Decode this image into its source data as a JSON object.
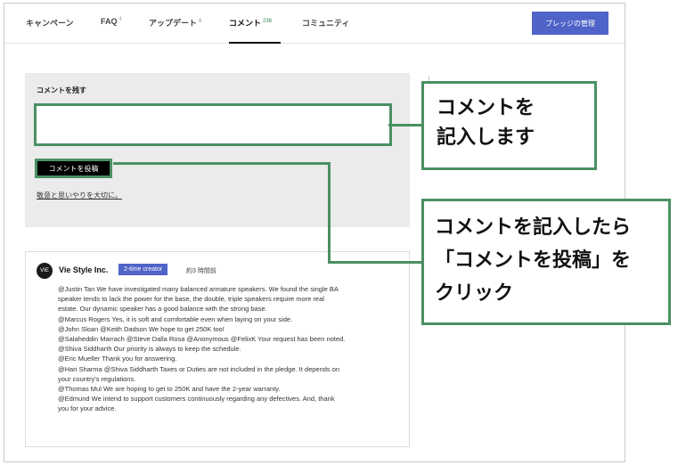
{
  "nav": {
    "tabs": [
      {
        "label": "キャンペーン",
        "count": ""
      },
      {
        "label": "FAQ",
        "count": "4"
      },
      {
        "label": "アップデート",
        "count": "6"
      },
      {
        "label": "コメント",
        "count": "236"
      },
      {
        "label": "コミュニティ",
        "count": ""
      }
    ],
    "active_tab": "コメント",
    "pledge_button": "プレッジの管理"
  },
  "comment_form": {
    "title": "コメントを残す",
    "input_value": "",
    "submit_label": "コメントを投稿",
    "policy_link": "敬意と思いやりを大切に。"
  },
  "comment": {
    "avatar_text": "VIE",
    "author": "Vie Style Inc.",
    "badge": "2-time creator",
    "time": "約3 時間前",
    "lines": [
      "@Justin Tan We have investigated many balanced armature speakers. We found the single BA",
      "speaker tends to lack the power for the base, the double, triple speakers require more real",
      "estate. Our dynamic speaker has a good balance with the strong base.",
      "@Marcus Rogers Yes, it is soft and comfortable even when laying on your side.",
      "@John Sloan @Keith Dadson We hope to get 250K too!",
      "@Salaheddin Marrach @Steve Dalla Rosa @Anonymous @FelixK Your request has been noted.",
      "@Shiva Siddharth Our priority is always to keep the schedule.",
      "@Eric Mueller Thank you for answering.",
      "@Hari Sharma @Shiva Siddharth Taxes or Duties are not included in the pledge. It depends on",
      "your country's regulations.",
      "@Thomas Mul We are hoping to get to 250K and have the 2-year warranty.",
      "@Edmund We intend to support customers continuously regarding any defectives. And, thank",
      "you for your advice."
    ]
  },
  "callouts": {
    "input_note": [
      "コメントを",
      "記入します"
    ],
    "submit_note": [
      "コメントを記入したら",
      "「コメントを投稿」を",
      "クリック"
    ]
  },
  "colors": {
    "accent_blue": "#4f63c8",
    "highlight_green": "#4a8f63",
    "panel_gray": "#ebebeb"
  }
}
